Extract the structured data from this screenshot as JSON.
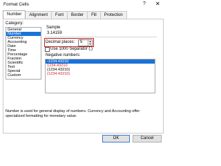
{
  "window": {
    "title": "Format Cells",
    "help": "?",
    "close": "✕"
  },
  "tabs": [
    "Number",
    "Alignment",
    "Font",
    "Border",
    "Fill",
    "Protection"
  ],
  "category": {
    "label": "Category:",
    "items": [
      "General",
      "Number",
      "Currency",
      "Accounting",
      "Date",
      "Time",
      "Percentage",
      "Fraction",
      "Scientific",
      "Text",
      "Special",
      "Custom"
    ],
    "selected_index": 1
  },
  "sample": {
    "label": "Sample",
    "value": "3.14159"
  },
  "decimal_places": {
    "label": "Decimal places:",
    "value": "5"
  },
  "separator": {
    "label": "Use 1000 Separator (,)",
    "checked": false
  },
  "negative_numbers": {
    "label": "Negative numbers:",
    "items": [
      {
        "text": "-1234.43210",
        "color": "#000000"
      },
      {
        "text": "1234.43210",
        "color": "#d01c1c"
      },
      {
        "text": "(1234.43210)",
        "color": "#000000"
      },
      {
        "text": "(1234.43210)",
        "color": "#d01c1c"
      }
    ],
    "selected_index": 0
  },
  "description": "Number is used for general display of numbers.  Currency and Accounting offer specialized formatting for monetary value.",
  "buttons": {
    "ok": "OK",
    "cancel": "Cancel"
  },
  "colors": {
    "selection": "#1a73d9",
    "highlight": "#d01c1c"
  }
}
